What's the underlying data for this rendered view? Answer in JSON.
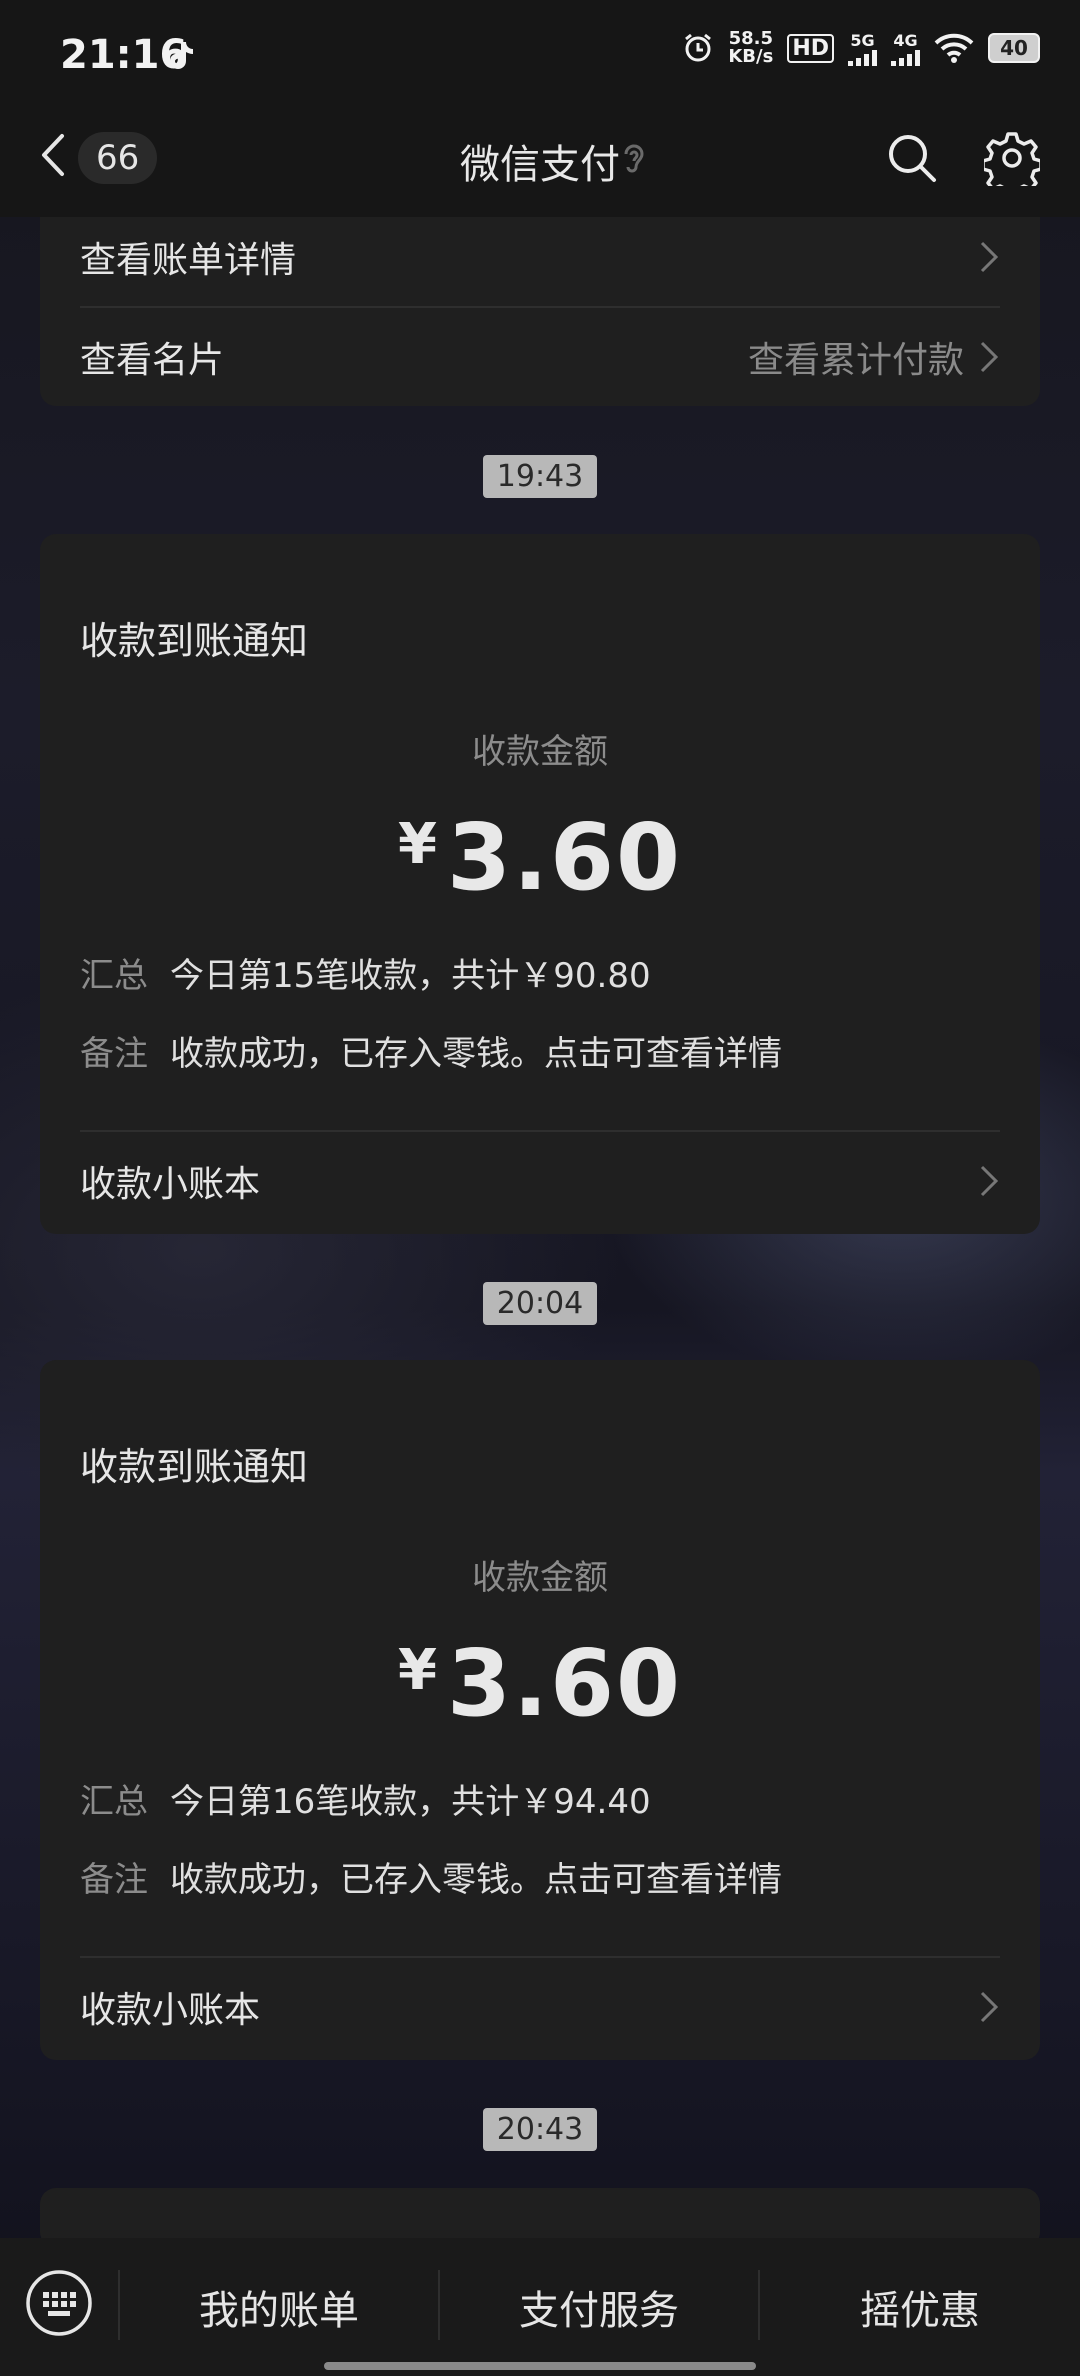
{
  "status": {
    "time": "21:16",
    "net_speed_value": "58.5",
    "net_speed_unit": "KB/s",
    "hd_label": "HD",
    "sim1_label": "5G",
    "sim2_label": "4G",
    "battery": "40"
  },
  "nav": {
    "unread_count": "66",
    "title": "微信支付"
  },
  "top_card": {
    "row1_label": "查看账单详情",
    "row2_label": "查看名片",
    "row2_right": "查看累计付款"
  },
  "messages": [
    {
      "time": "19:43",
      "title": "收款到账通知",
      "amount_label": "收款金额",
      "currency": "¥",
      "amount": "3.60",
      "summary_key": "汇总",
      "summary_val": "今日第15笔收款，共计￥90.80",
      "note_key": "备注",
      "note_val": "收款成功，已存入零钱。点击可查看详情",
      "link": "收款小账本"
    },
    {
      "time": "20:04",
      "title": "收款到账通知",
      "amount_label": "收款金额",
      "currency": "¥",
      "amount": "3.60",
      "summary_key": "汇总",
      "summary_val": "今日第16笔收款，共计￥94.40",
      "note_key": "备注",
      "note_val": "收款成功，已存入零钱。点击可查看详情",
      "link": "收款小账本"
    },
    {
      "time": "20:43"
    }
  ],
  "bottom": {
    "tab1": "我的账单",
    "tab2": "支付服务",
    "tab3": "摇优惠"
  }
}
